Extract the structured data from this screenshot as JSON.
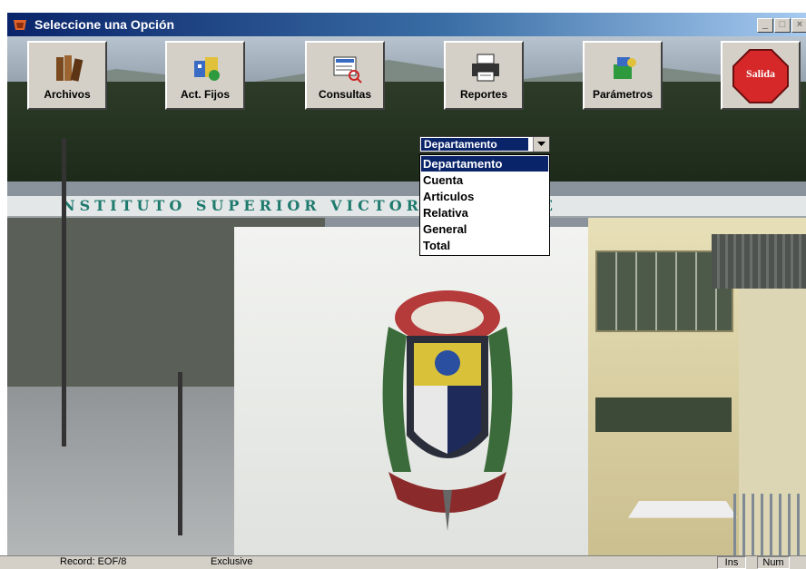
{
  "window": {
    "title": "Seleccione una Opción",
    "minimize_glyph": "_",
    "maximize_glyph": "□",
    "close_glyph": "×"
  },
  "toolbar": {
    "buttons": [
      {
        "label": "Archivos",
        "icon": "books-icon"
      },
      {
        "label": "Act. Fijos",
        "icon": "assets-icon"
      },
      {
        "label": "Consultas",
        "icon": "query-icon"
      },
      {
        "label": "Reportes",
        "icon": "printer-icon"
      },
      {
        "label": "Parámetros",
        "icon": "parameters-icon"
      },
      {
        "label": "Salida",
        "icon": "stop-sign-icon"
      }
    ]
  },
  "report_select": {
    "selected": "Departamento",
    "options": [
      "Departamento",
      "Cuenta",
      "Articulos",
      "Relativa",
      "General",
      "Total"
    ]
  },
  "background": {
    "banner_text": "NSTITUTO SUPERIOR VICTORIA VA          LIVE"
  },
  "statusbar": {
    "record": "Record: EOF/8",
    "mode": "Exclusive",
    "ins": "Ins",
    "num": "Num"
  },
  "colors": {
    "title_bar": "#0a246a",
    "button_face": "#d4d0c8",
    "selection": "#0a246a",
    "stop_red": "#d62828"
  }
}
